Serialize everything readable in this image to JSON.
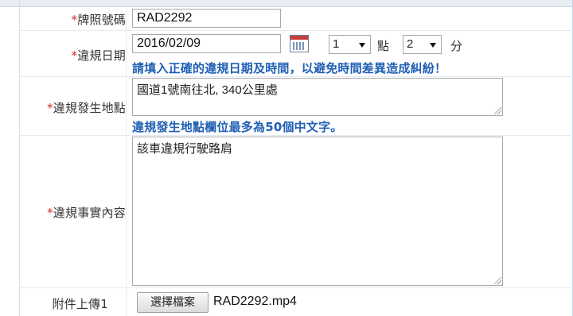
{
  "form": {
    "required_mark": "*",
    "plate": {
      "label": "牌照號碼",
      "value": "RAD2292"
    },
    "date": {
      "label": "違規日期",
      "value": "2016/02/09",
      "hour_value": "1",
      "hour_unit": "點",
      "minute_value": "2",
      "minute_unit": "分",
      "note": "請填入正確的違規日期及時間，以避免時間差異造成糾紛！"
    },
    "location": {
      "label": "違規發生地點",
      "value": "國道1號南往北, 340公里處",
      "note": "違規發生地點欄位最多為50個中文字。"
    },
    "facts": {
      "label": "違規事實內容",
      "value": "該車違規行駛路肩"
    },
    "attachment": {
      "label": "附件上傳1",
      "button_label": "選擇檔案",
      "file_name": "RAD2292.mp4"
    }
  },
  "colors": {
    "required": "#d02828",
    "note": "#1f5fb4"
  },
  "icons": {
    "date_picker": "calendar-icon",
    "dropdown": "chevron-down-icon"
  }
}
